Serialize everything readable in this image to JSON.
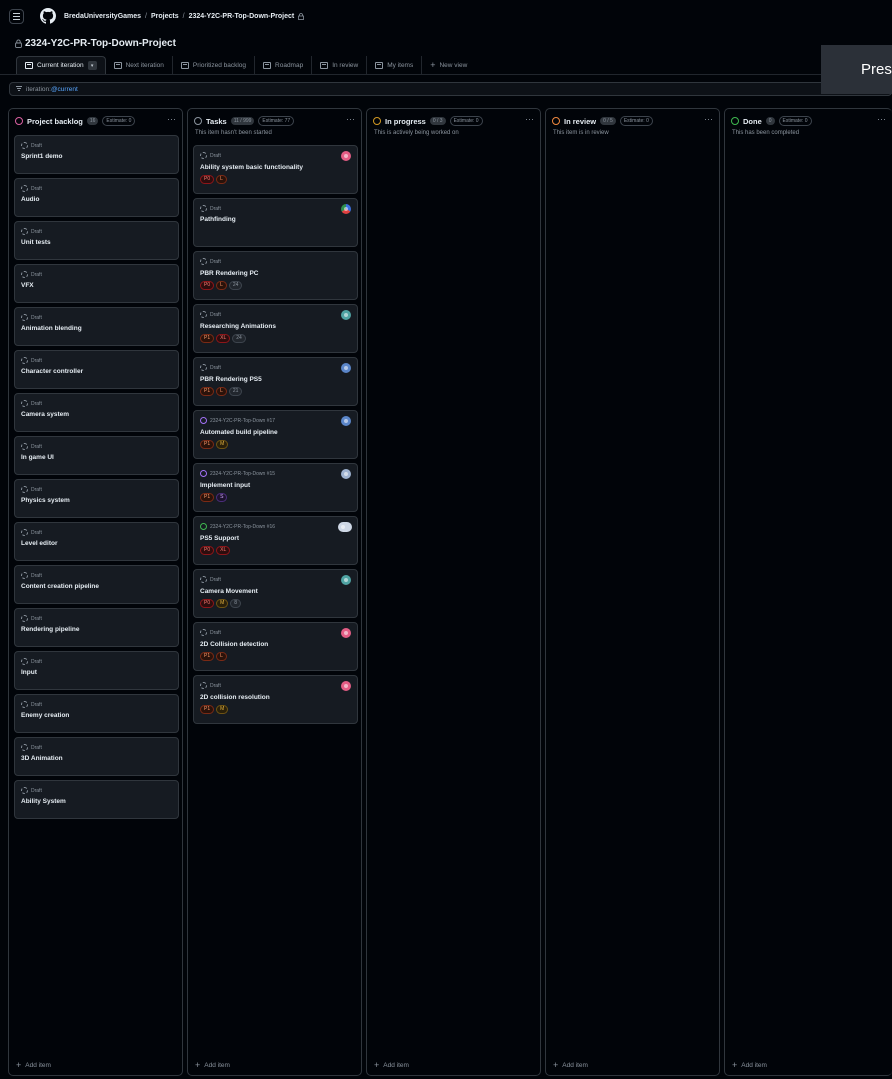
{
  "header": {
    "org": "BredaUniversityGames",
    "projects": "Projects",
    "project": "2324-Y2C-PR-Top-Down-Project",
    "title": "2324-Y2C-PR-Top-Down-Project"
  },
  "tabs": [
    {
      "label": "Current iteration"
    },
    {
      "label": "Next iteration"
    },
    {
      "label": "Prioritized backlog"
    },
    {
      "label": "Roadmap"
    },
    {
      "label": "In review"
    },
    {
      "label": "My items"
    },
    {
      "label": "New view"
    }
  ],
  "filter": {
    "key": "iteration:",
    "value": "@current"
  },
  "overlay": {
    "text": "Press"
  },
  "add_item_label": "Add item",
  "columns": [
    {
      "title": "Project backlog",
      "count": "16",
      "estimate": "Estimate: 0",
      "desc": "",
      "color": "#db61a2",
      "cards": [
        {
          "meta": "Draft",
          "title": "Sprint1 demo"
        },
        {
          "meta": "Draft",
          "title": "Audio"
        },
        {
          "meta": "Draft",
          "title": "Unit tests"
        },
        {
          "meta": "Draft",
          "title": "VFX"
        },
        {
          "meta": "Draft",
          "title": "Animation blending"
        },
        {
          "meta": "Draft",
          "title": "Character controller"
        },
        {
          "meta": "Draft",
          "title": "Camera system"
        },
        {
          "meta": "Draft",
          "title": "In game UI"
        },
        {
          "meta": "Draft",
          "title": "Physics system"
        },
        {
          "meta": "Draft",
          "title": "Level editor"
        },
        {
          "meta": "Draft",
          "title": "Content creation pipeline"
        },
        {
          "meta": "Draft",
          "title": "Rendering pipeline"
        },
        {
          "meta": "Draft",
          "title": "Input"
        },
        {
          "meta": "Draft",
          "title": "Enemy creation"
        },
        {
          "meta": "Draft",
          "title": "3D Animation"
        },
        {
          "meta": "Draft",
          "title": "Ability System"
        }
      ]
    },
    {
      "title": "Tasks",
      "count": "11 / 999",
      "estimate": "Estimate: 77",
      "desc": "This item hasn't been started",
      "color": "#8b949e",
      "cards": [
        {
          "meta": "Draft",
          "title": "Ability system basic functionality",
          "labels": [
            "P0",
            "L"
          ],
          "avatar": "pink-avatar"
        },
        {
          "meta": "Draft",
          "title": "Pathfinding",
          "labels": [],
          "avatar": "multi-avatar"
        },
        {
          "meta": "Draft",
          "title": "PBR Rendering PC",
          "labels": [
            "P0",
            "L",
            "24"
          ],
          "avatar": ""
        },
        {
          "meta": "Draft",
          "title": "Researching Animations",
          "labels": [
            "P1",
            "XL",
            "24"
          ],
          "avatar": "teal-avatar"
        },
        {
          "meta": "Draft",
          "title": "PBR Rendering PS5",
          "labels": [
            "P1",
            "L",
            "21"
          ],
          "avatar": "blue-avatar"
        },
        {
          "meta": "2324-Y2C-PR-Top-Down #17",
          "title": "Automated build pipeline",
          "labels": [
            "P1",
            "M"
          ],
          "avatar": "blue-avatar",
          "issue": "closed"
        },
        {
          "meta": "2324-Y2C-PR-Top-Down #15",
          "title": "Implement input",
          "labels": [
            "P1",
            "S"
          ],
          "avatar": "light-avatar",
          "issue": "closed"
        },
        {
          "meta": "2324-Y2C-PR-Top-Down #16",
          "title": "PS5 Support",
          "labels": [
            "P0",
            "XL"
          ],
          "avatar": "pair-avatar",
          "issue": "open"
        },
        {
          "meta": "Draft",
          "title": "Camera Movement",
          "labels": [
            "P0",
            "M",
            "8"
          ],
          "avatar": "teal-avatar"
        },
        {
          "meta": "Draft",
          "title": "2D Collision detection",
          "labels": [
            "P1",
            "L"
          ],
          "avatar": "pink-avatar"
        },
        {
          "meta": "Draft",
          "title": "2D collision resolution",
          "labels": [
            "P1",
            "M"
          ],
          "avatar": "pink-avatar"
        }
      ]
    },
    {
      "title": "In progress",
      "count": "0 / 3",
      "estimate": "Estimate: 0",
      "desc": "This is actively being worked on",
      "color": "#d29922",
      "cards": []
    },
    {
      "title": "In review",
      "count": "0 / 5",
      "estimate": "Estimate: 0",
      "desc": "This item is in review",
      "color": "#f0883e",
      "cards": []
    },
    {
      "title": "Done",
      "count": "0",
      "estimate": "Estimate: 0",
      "desc": "This has been completed",
      "color": "#3fb950",
      "cards": []
    }
  ]
}
